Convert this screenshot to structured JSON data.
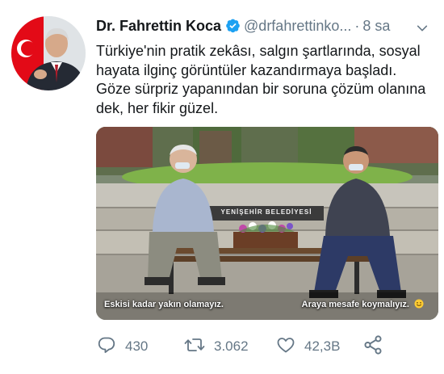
{
  "tweet": {
    "author_name": "Dr. Fahrettin Koca",
    "handle": "@drfahrettinko...",
    "separator": "·",
    "time": "8 sa",
    "text": "Türkiye'nin pratik zekâsı, salgın şartlarında, sosyal hayata ilginç görüntüler kazandırmaya başladı. Göze sürpriz yapanından bir soruna çözüm olanına dek, her fikir güzel.",
    "media": {
      "sign_text": "YENİŞEHİR BELEDİYESİ",
      "caption_left": "Eskisi kadar yakın olamayız.",
      "caption_right": "Araya mesafe koymalıyız.",
      "caption_right_emoji": "smiling-face-emoji"
    },
    "stats": {
      "replies": "430",
      "retweets": "3.062",
      "likes": "42,3B"
    }
  },
  "icons": {
    "verified": "verified-badge-icon",
    "more": "chevron-down-icon",
    "reply": "reply-icon",
    "retweet": "retweet-icon",
    "like": "heart-icon",
    "share": "share-icon"
  },
  "colors": {
    "verified": "#1da1f2",
    "secondary_text": "#657786",
    "primary_text": "#14171a",
    "flag_red": "#e30a17"
  }
}
